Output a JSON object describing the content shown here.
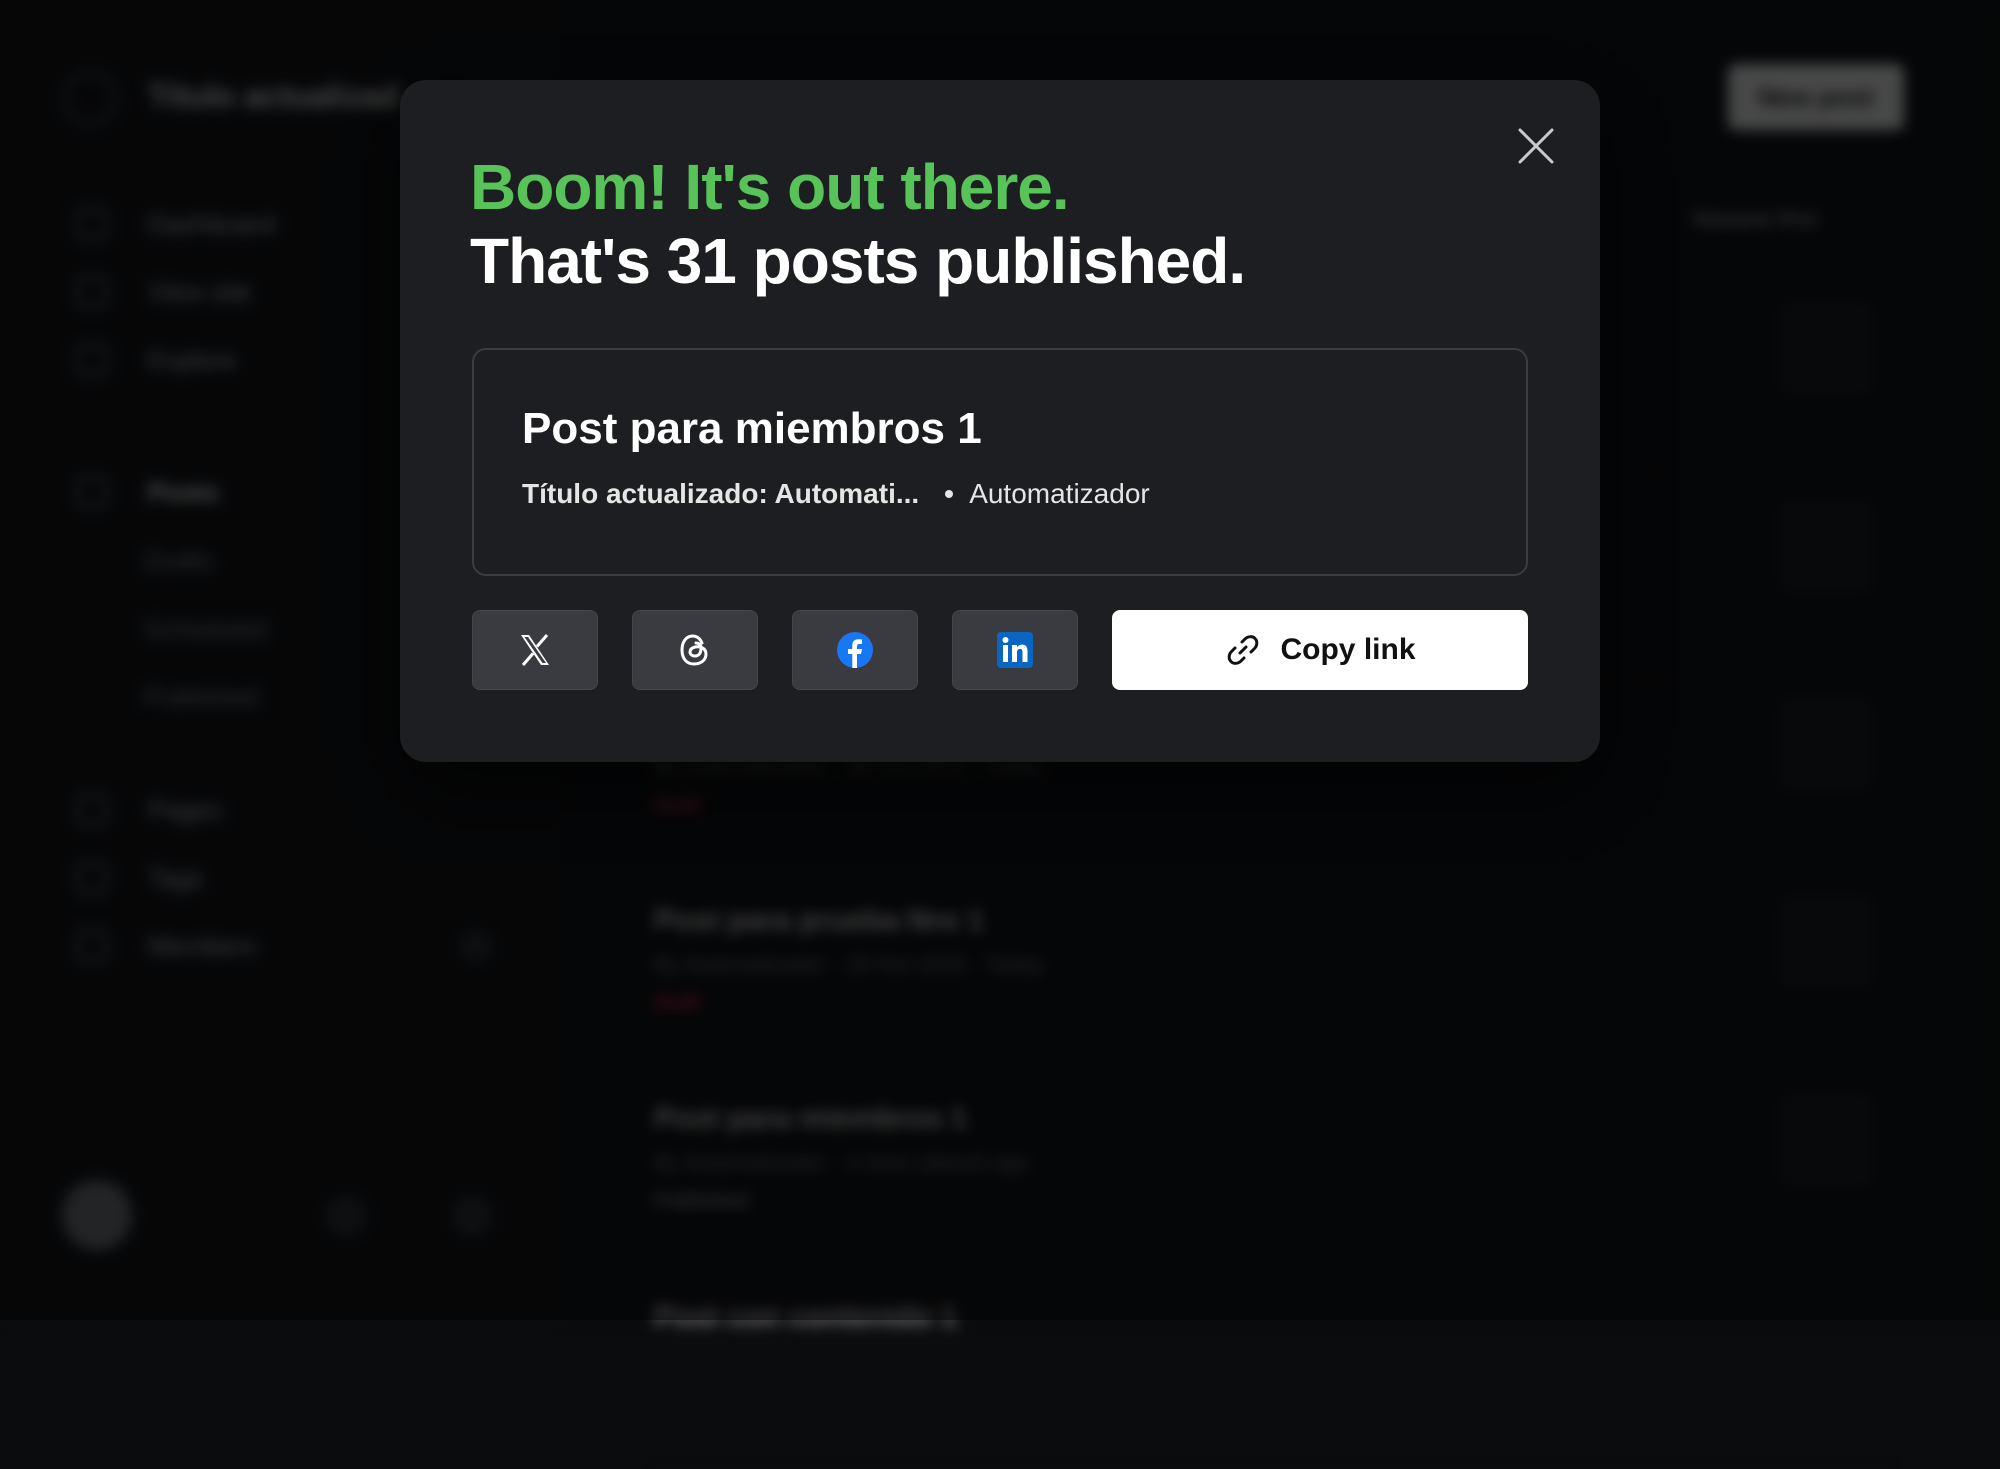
{
  "background": {
    "site_title": "Título actualizad",
    "nav": {
      "dashboard": "Dashboard",
      "view_site": "View site",
      "explore": "Explore",
      "posts": "Posts",
      "drafts": "Drafts",
      "scheduled": "Scheduled",
      "published": "Published",
      "pages": "Pages",
      "tags": "Tags",
      "members": "Members"
    },
    "header": {
      "new_post": "New post",
      "sort": "Newest first"
    },
    "posts": [
      {
        "title": "",
        "meta": "",
        "status": ""
      },
      {
        "title": "",
        "meta": "",
        "status": ""
      },
      {
        "title": "",
        "meta": "By Automatizador · 28 Oct 2025 · Today",
        "status": "Draft"
      },
      {
        "title": "Post para prueba Nro 1",
        "meta": "By Automatizador · 28 Oct 2025 · Today",
        "status": "Draft"
      },
      {
        "title": "Post para miembros 1",
        "meta": "By Automatizador · 2 mins (about) ago",
        "status": "Published"
      },
      {
        "title": "Post con contenido 1",
        "meta": "",
        "status": ""
      }
    ]
  },
  "modal": {
    "heading_highlight": "Boom! It's out there.",
    "heading_main": "That's 31 posts published.",
    "post_card": {
      "title": "Post para miembros 1",
      "site_name": "Título actualizado: Automati...",
      "author": "Automatizador"
    },
    "share": {
      "x_icon": "x-logo-icon",
      "threads_icon": "threads-logo-icon",
      "facebook_icon": "facebook-logo-icon",
      "linkedin_icon": "linkedin-logo-icon",
      "copy_link_label": "Copy link",
      "copy_link_icon": "link-icon"
    },
    "colors": {
      "highlight": "#57c359",
      "facebook": "#1877f2",
      "linkedin": "#0a66c2"
    }
  }
}
